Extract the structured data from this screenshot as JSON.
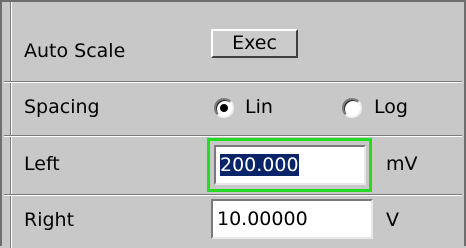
{
  "auto_scale": {
    "label": "Auto Scale",
    "button_label": "Exec"
  },
  "spacing": {
    "label": "Spacing",
    "options": [
      {
        "label": "Lin",
        "selected": true
      },
      {
        "label": "Log",
        "selected": false
      }
    ]
  },
  "left": {
    "label": "Left",
    "value": "200.000",
    "unit": "mV",
    "focused": true
  },
  "right": {
    "label": "Right",
    "value": "10.00000",
    "unit": "V"
  },
  "colors": {
    "panel_bg": "#c8c8c8",
    "focus_border": "#22dd22",
    "selection_bg": "#0a246a",
    "selection_text": "#ffffff"
  }
}
